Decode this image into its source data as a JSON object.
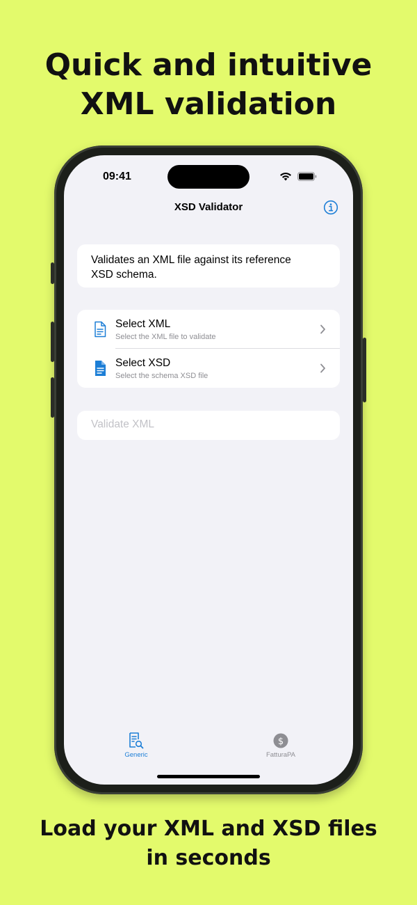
{
  "marketing": {
    "headline_line1": "Quick and intuitive",
    "headline_line2": "XML validation",
    "subline_line1": "Load your XML and XSD files",
    "subline_line2": "in seconds"
  },
  "status_bar": {
    "time": "09:41"
  },
  "nav": {
    "title": "XSD Validator",
    "info_icon": "info-circle-icon"
  },
  "description": {
    "line1": "Validates an XML file against its reference",
    "line2": "XSD schema."
  },
  "file_list": {
    "items": [
      {
        "title": "Select XML",
        "subtitle": "Select the XML file to validate",
        "icon": "document-outline-icon"
      },
      {
        "title": "Select XSD",
        "subtitle": "Select the schema XSD file",
        "icon": "document-filled-icon"
      }
    ]
  },
  "validate_button": {
    "label": "Validate XML"
  },
  "tab_bar": {
    "tabs": [
      {
        "label": "Generic",
        "selected": true,
        "icon": "document-search-icon"
      },
      {
        "label": "FatturaPA",
        "selected": false,
        "icon": "dollar-circle-icon"
      }
    ]
  },
  "colors": {
    "background": "#e3fa6c",
    "accent": "#1c7ed6",
    "inactive": "#8e8e93"
  }
}
